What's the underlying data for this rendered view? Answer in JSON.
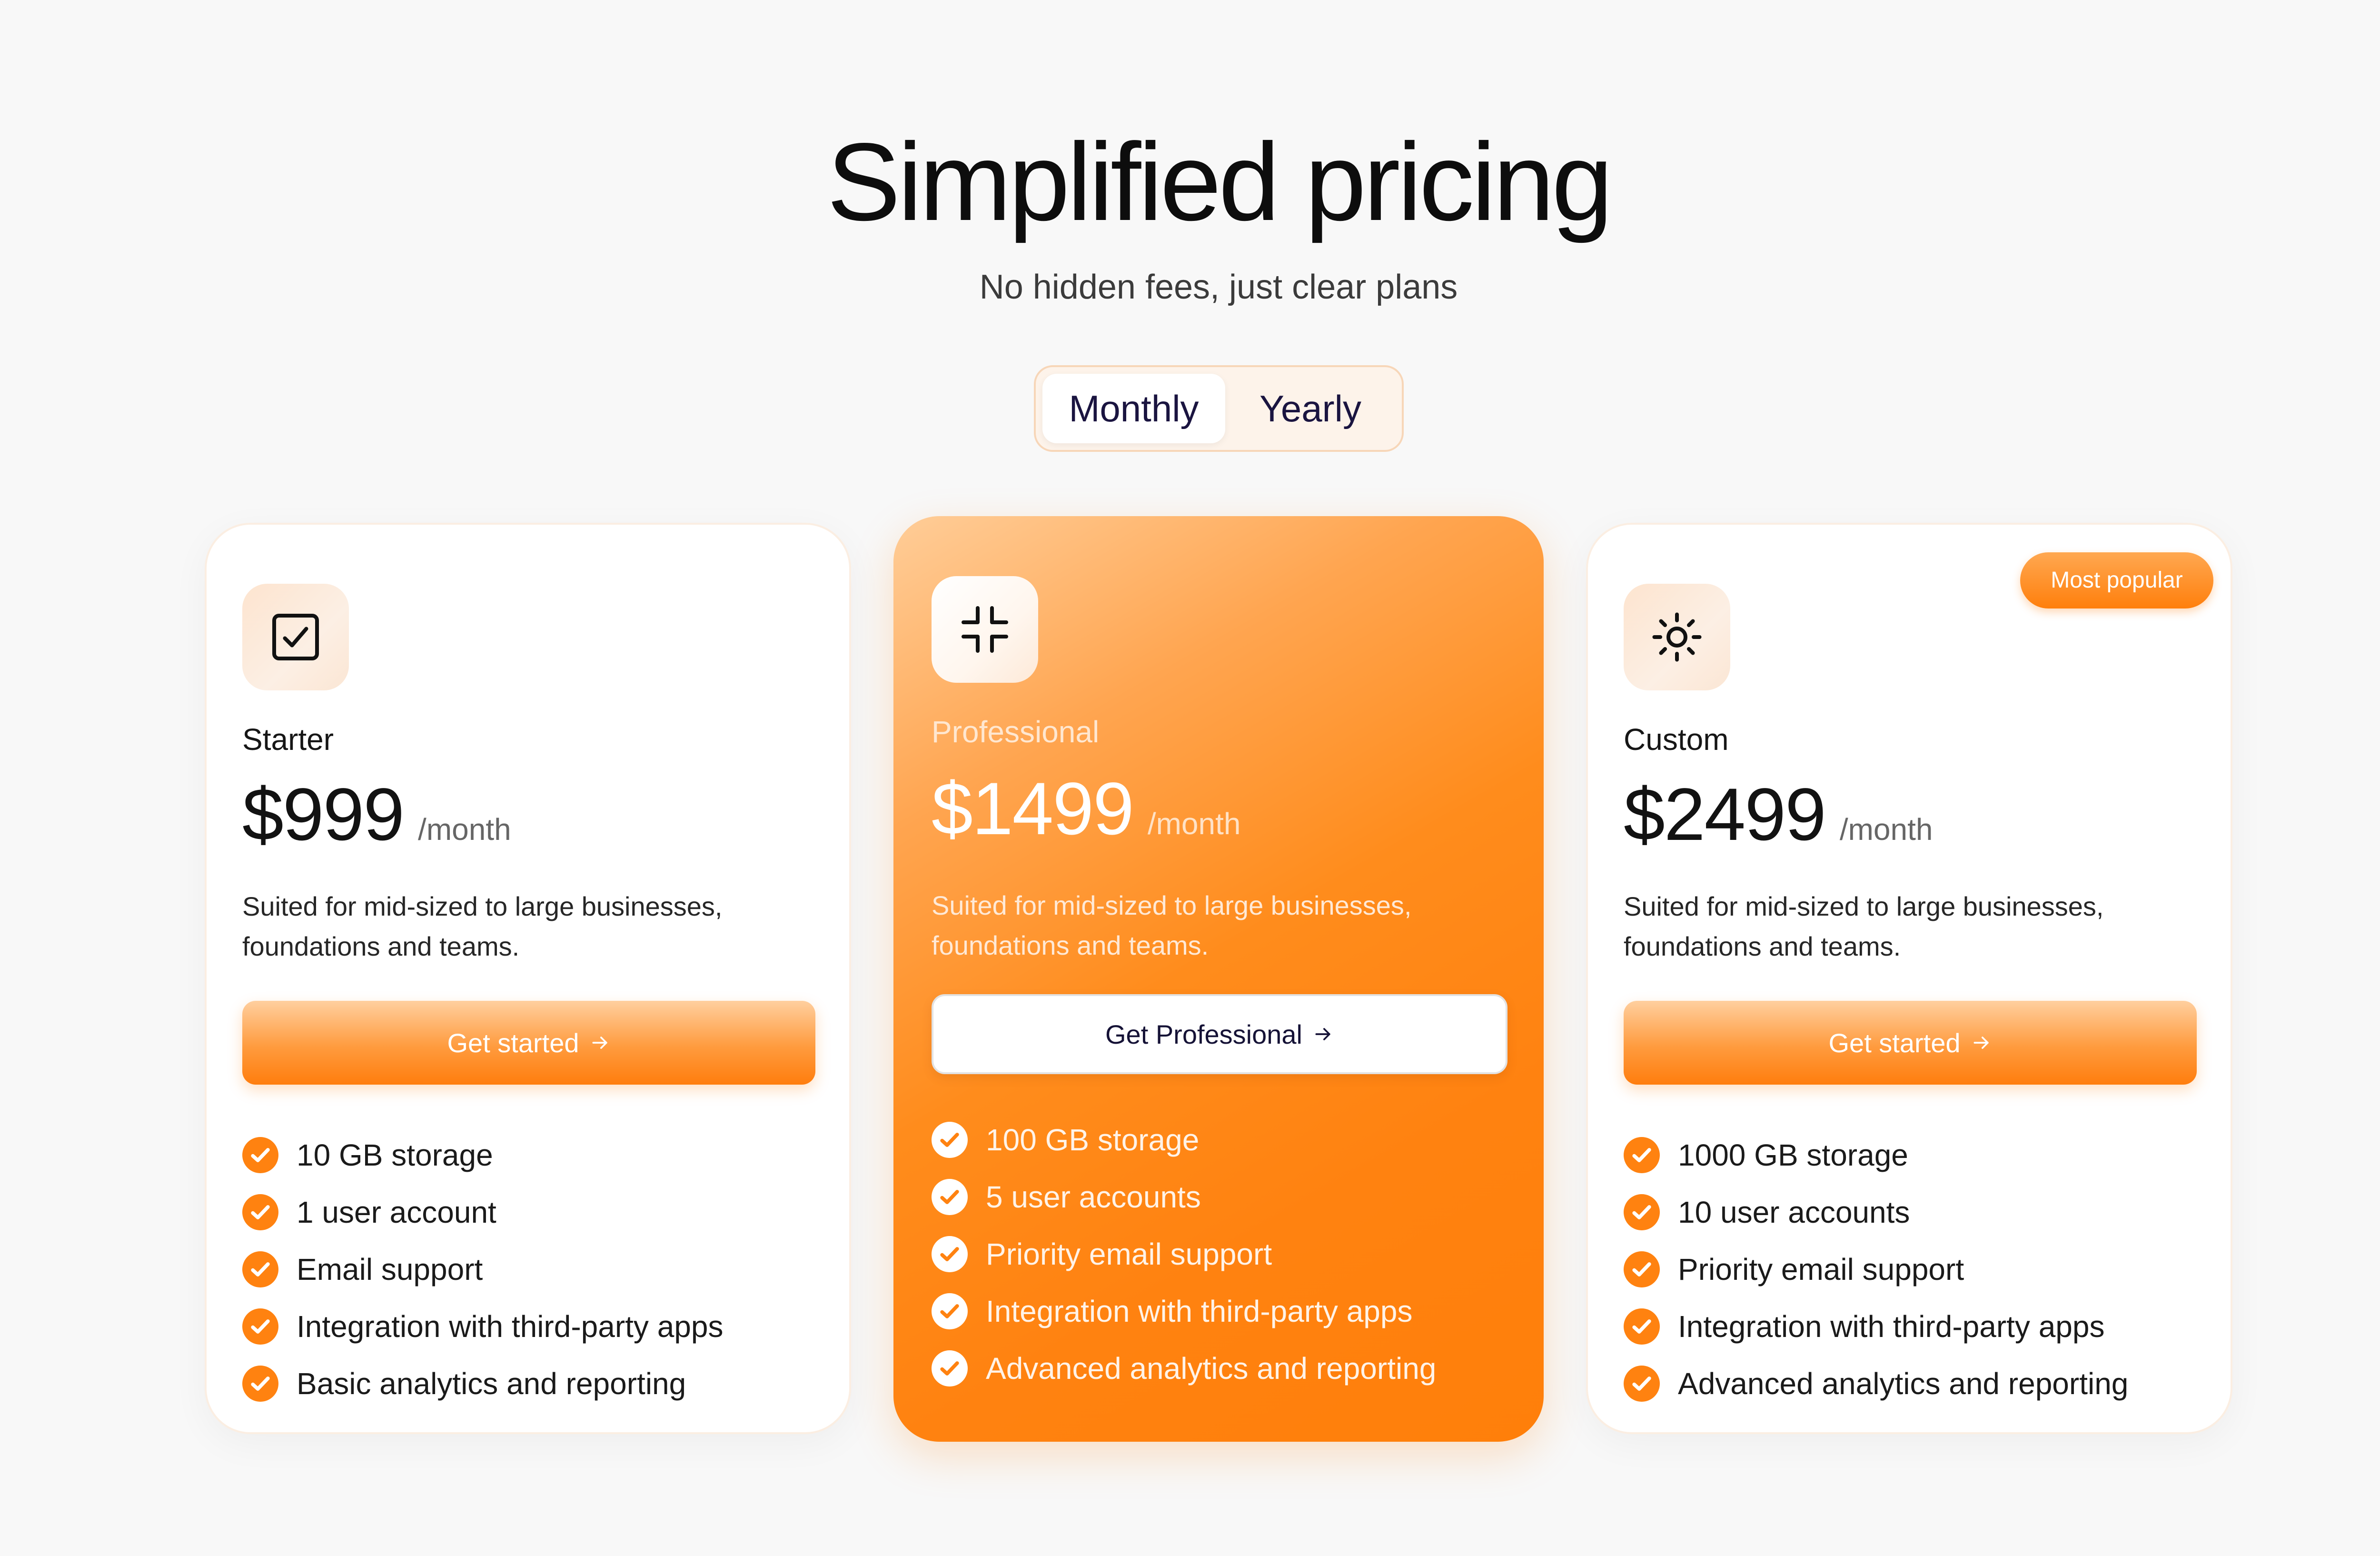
{
  "header": {
    "title": "Simplified pricing",
    "subtitle": "No hidden fees, just clear plans"
  },
  "billing_toggle": {
    "options": [
      "Monthly",
      "Yearly"
    ],
    "selected": "Monthly"
  },
  "plans": [
    {
      "icon": "checkbox-icon",
      "name": "Starter",
      "price": "$999",
      "period": "/month",
      "description": "Suited for mid-sized to large businesses, foundations and teams.",
      "cta": "Get started",
      "features": [
        "10 GB storage",
        "1 user account",
        "Email support",
        "Integration with third-party apps",
        "Basic analytics and reporting"
      ]
    },
    {
      "icon": "collapse-icon",
      "name": "Professional",
      "price": "$1499",
      "period": "/month",
      "description": "Suited for mid-sized to large businesses, foundations and teams.",
      "cta": "Get Professional",
      "features": [
        "100 GB storage",
        "5 user accounts",
        "Priority email support",
        "Integration with third-party apps",
        "Advanced analytics and reporting"
      ]
    },
    {
      "icon": "sun-icon",
      "name": "Custom",
      "price": "$2499",
      "period": "/month",
      "badge": "Most popular",
      "description": "Suited for mid-sized to large businesses, foundations and teams.",
      "cta": "Get started",
      "features": [
        "1000 GB storage",
        "10 user accounts",
        "Priority email support",
        "Integration with third-party apps",
        "Advanced analytics and reporting"
      ]
    }
  ],
  "colors": {
    "accent": "#ff8210",
    "background": "#f8f8f8",
    "card": "#ffffff"
  }
}
